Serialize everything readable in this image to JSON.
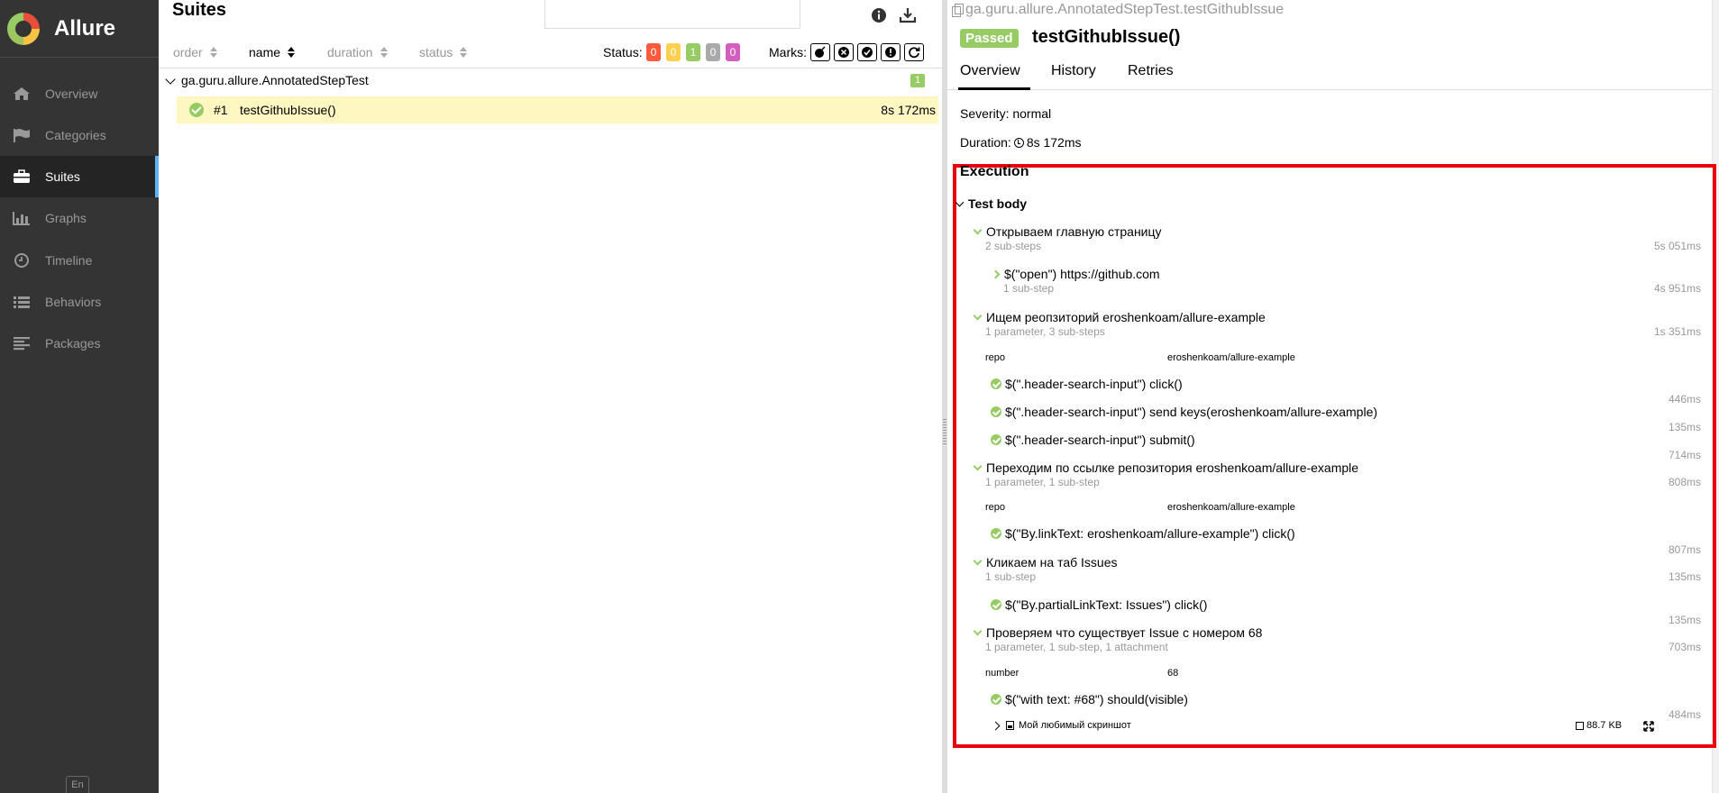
{
  "app": {
    "name": "Allure"
  },
  "sidebar": {
    "items": [
      {
        "label": "Overview",
        "icon": "home-icon"
      },
      {
        "label": "Categories",
        "icon": "flag-icon"
      },
      {
        "label": "Suites",
        "icon": "briefcase-icon",
        "active": true
      },
      {
        "label": "Graphs",
        "icon": "bar-chart-icon"
      },
      {
        "label": "Timeline",
        "icon": "clock-icon"
      },
      {
        "label": "Behaviors",
        "icon": "list-icon"
      },
      {
        "label": "Packages",
        "icon": "align-left-icon"
      }
    ],
    "language": "En"
  },
  "suites": {
    "title": "Suites",
    "search_value": "",
    "sort": {
      "order": "order",
      "name": "name",
      "duration": "duration",
      "status": "status"
    },
    "status_label": "Status:",
    "status_counts": [
      {
        "value": "0",
        "color": "#fd5a3e"
      },
      {
        "value": "0",
        "color": "#ffd050"
      },
      {
        "value": "1",
        "color": "#97cc64"
      },
      {
        "value": "0",
        "color": "#aaaaaa"
      },
      {
        "value": "0",
        "color": "#d35ebe"
      }
    ],
    "marks_label": "Marks:",
    "group": {
      "name": "ga.guru.allure.AnnotatedStepTest",
      "count": "1"
    },
    "test": {
      "number": "#1",
      "name": "testGithubIssue()",
      "duration": "8s 172ms"
    }
  },
  "detail": {
    "path": "ga.guru.allure.AnnotatedStepTest.testGithubIssue",
    "status": "Passed",
    "title": "testGithubIssue()",
    "tabs": [
      "Overview",
      "History",
      "Retries"
    ],
    "severity": "Severity: normal",
    "duration_label": "Duration:",
    "duration_value": "8s 172ms",
    "execution_title": "Execution",
    "test_body": "Test body",
    "steps": {
      "s1": {
        "title": "Открываем главную страницу",
        "sub": "2 sub-steps",
        "dur": "5s 051ms"
      },
      "s1a": {
        "title": "$(\"open\") https://github.com",
        "sub": "1 sub-step",
        "dur": "4s 951ms"
      },
      "s2": {
        "title": "Ищем реопзиторий eroshenkoam/allure-example",
        "sub": "1 parameter, 3 sub-steps",
        "dur": "1s 351ms",
        "param_name": "repo",
        "param_value": "eroshenkoam/allure-example"
      },
      "s2a": {
        "title": "$(\".header-search-input\") click()",
        "dur": "446ms"
      },
      "s2b": {
        "title": "$(\".header-search-input\") send keys(eroshenkoam/allure-example)",
        "dur": "135ms"
      },
      "s2c": {
        "title": "$(\".header-search-input\") submit()",
        "dur": "714ms"
      },
      "s3": {
        "title": "Переходим по ссылке репозитория eroshenkoam/allure-example",
        "sub": "1 parameter, 1 sub-step",
        "dur": "808ms",
        "param_name": "repo",
        "param_value": "eroshenkoam/allure-example"
      },
      "s3a": {
        "title": "$(\"By.linkText: eroshenkoam/allure-example\") click()",
        "dur": "807ms"
      },
      "s4": {
        "title": "Кликаем на таб Issues",
        "sub": "1 sub-step",
        "dur": "135ms"
      },
      "s4a": {
        "title": "$(\"By.partialLinkText: Issues\") click()",
        "dur": "135ms"
      },
      "s5": {
        "title": "Проверяем что существует Issue с номером 68",
        "sub": "1 parameter, 1 sub-step, 1 attachment",
        "dur": "703ms",
        "param_name": "number",
        "param_value": "68"
      },
      "s5a": {
        "title": "$(\"with text: #68\") should(visible)",
        "dur": "484ms"
      }
    },
    "attachment": {
      "name": "Мой любимый скриншот",
      "size": "88.7 KB"
    }
  }
}
